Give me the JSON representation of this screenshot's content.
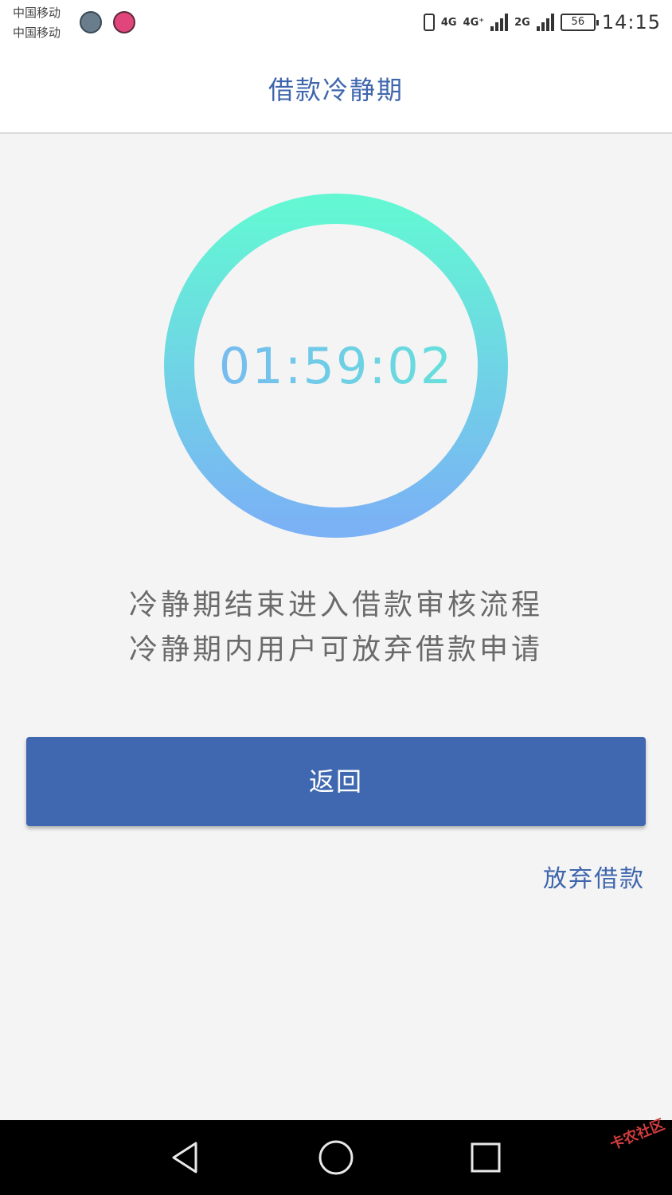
{
  "status_bar": {
    "carrier_1": "中国移动",
    "carrier_2": "中国移动",
    "network_1": "4G",
    "network_2": "4G⁺",
    "network_3": "2G",
    "battery": "56",
    "time": "14:15"
  },
  "header": {
    "title": "借款冷静期"
  },
  "countdown": {
    "time": "01:59:02",
    "ring_gradient_top": "#63f7d4",
    "ring_gradient_bottom": "#7ab2f5"
  },
  "description": {
    "line1": "冷静期结束进入借款审核流程",
    "line2": "冷静期内用户可放弃借款申请"
  },
  "actions": {
    "back_label": "返回",
    "abandon_label": "放弃借款"
  },
  "watermark": {
    "text": "卡农社区"
  },
  "colors": {
    "primary": "#4068b1",
    "title_text": "#3f66ad",
    "background": "#f4f4f4"
  }
}
